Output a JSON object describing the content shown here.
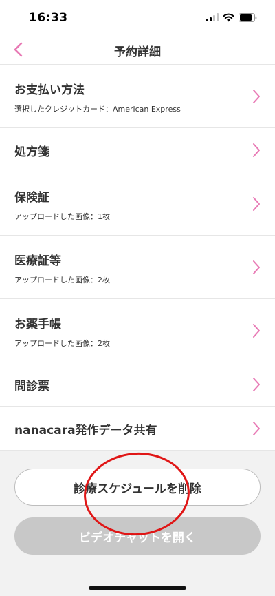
{
  "status_bar": {
    "time": "16:33",
    "icons": [
      "signal-icon",
      "wifi-icon",
      "battery-icon"
    ]
  },
  "nav": {
    "title": "予約詳細",
    "back_icon": "chevron-left-icon"
  },
  "items": [
    {
      "title": "お支払い方法",
      "subtitle": "選択したクレジットカード：American Express"
    },
    {
      "title": "処方箋"
    },
    {
      "title": "保険証",
      "subtitle": "アップロードした画像：1枚"
    },
    {
      "title": "医療証等",
      "subtitle": "アップロードした画像：2枚"
    },
    {
      "title": "お薬手帳",
      "subtitle": "アップロードした画像：2枚"
    },
    {
      "title": "問診票"
    },
    {
      "title": "nanacara発作データ共有"
    }
  ],
  "actions": {
    "delete_label": "診療スケジュールを削除",
    "video_label": "ビデオチャットを開く",
    "video_enabled": false
  },
  "colors": {
    "accent": "#e87ab5",
    "annotation": "#e01616",
    "disabled_button": "#c8c8c8",
    "background": "#f2f2f2"
  }
}
